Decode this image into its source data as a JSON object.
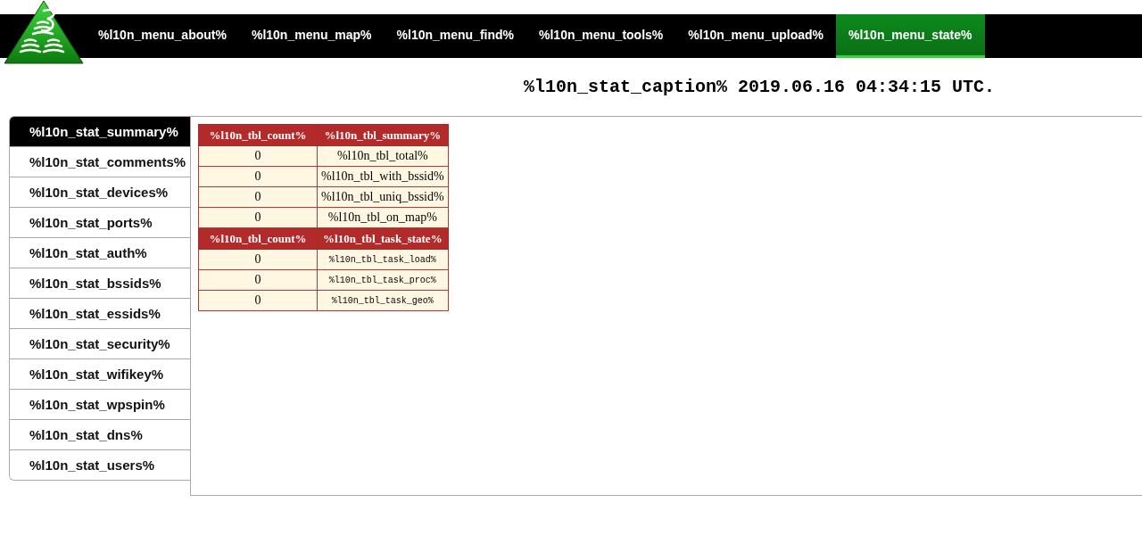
{
  "menu": [
    {
      "label": "%l10n_menu_about%",
      "selected": false
    },
    {
      "label": "%l10n_menu_map%",
      "selected": false
    },
    {
      "label": "%l10n_menu_find%",
      "selected": false
    },
    {
      "label": "%l10n_menu_tools%",
      "selected": false
    },
    {
      "label": "%l10n_menu_upload%",
      "selected": false
    },
    {
      "label": "%l10n_menu_state%",
      "selected": true
    }
  ],
  "caption": "%l10n_stat_caption% 2019.06.16 04:34:15 UTC.",
  "sidebar": {
    "items": [
      {
        "label": "%l10n_stat_summary%",
        "selected": true
      },
      {
        "label": "%l10n_stat_comments%",
        "selected": false
      },
      {
        "label": "%l10n_stat_devices%",
        "selected": false
      },
      {
        "label": "%l10n_stat_ports%",
        "selected": false
      },
      {
        "label": "%l10n_stat_auth%",
        "selected": false
      },
      {
        "label": "%l10n_stat_bssids%",
        "selected": false
      },
      {
        "label": "%l10n_stat_essids%",
        "selected": false
      },
      {
        "label": "%l10n_stat_security%",
        "selected": false
      },
      {
        "label": "%l10n_stat_wifikey%",
        "selected": false
      },
      {
        "label": "%l10n_stat_wpspin%",
        "selected": false
      },
      {
        "label": "%l10n_stat_dns%",
        "selected": false
      },
      {
        "label": "%l10n_stat_users%",
        "selected": false
      }
    ]
  },
  "table": {
    "sections": [
      {
        "kind": "plain",
        "columns": [
          "%l10n_tbl_count%",
          "%l10n_tbl_summary%"
        ],
        "rows": [
          {
            "count": "0",
            "label": "%l10n_tbl_total%"
          },
          {
            "count": "0",
            "label": "%l10n_tbl_with_bssid%"
          },
          {
            "count": "0",
            "label": "%l10n_tbl_uniq_bssid%"
          },
          {
            "count": "0",
            "label": "%l10n_tbl_on_map%"
          }
        ]
      },
      {
        "kind": "code",
        "columns": [
          "%l10n_tbl_count%",
          "%l10n_tbl_task_state%"
        ],
        "rows": [
          {
            "count": "0",
            "label": "%l10n_tbl_task_load%"
          },
          {
            "count": "0",
            "label": "%l10n_tbl_task_proc%"
          },
          {
            "count": "0",
            "label": "%l10n_tbl_task_geo%"
          }
        ]
      }
    ]
  }
}
